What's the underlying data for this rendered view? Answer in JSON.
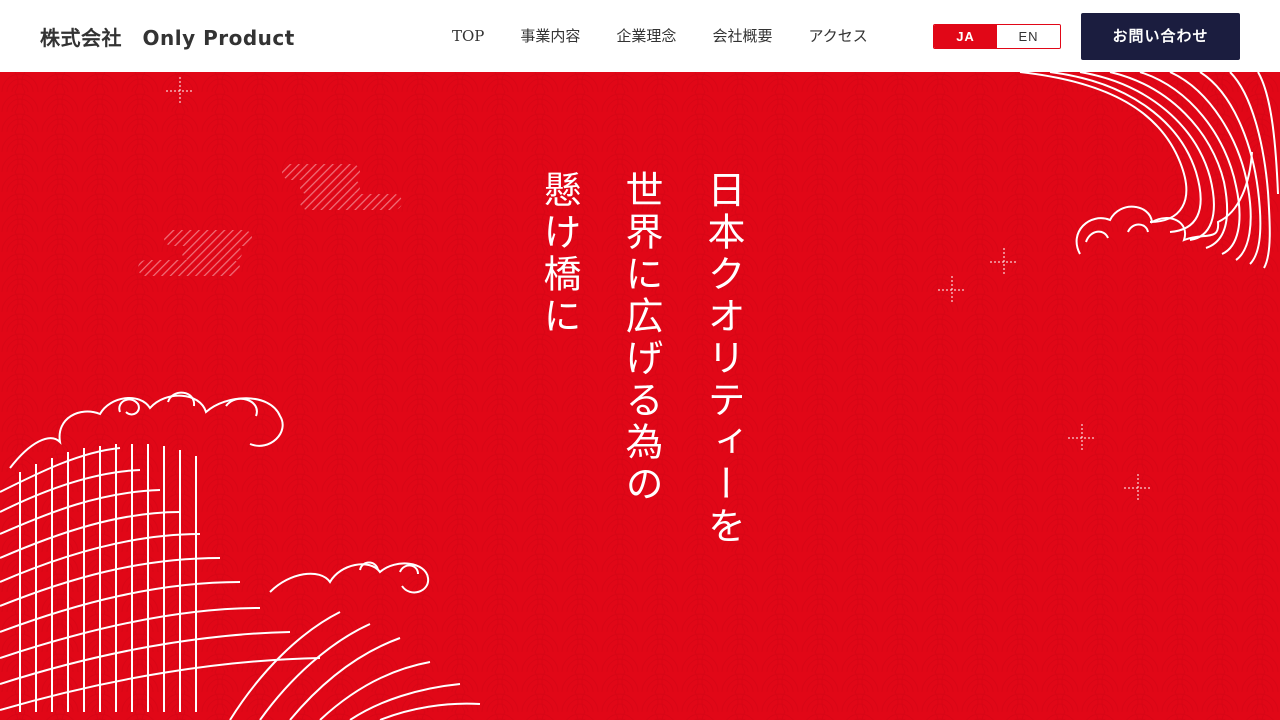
{
  "header": {
    "logo": "株式会社　Only Product",
    "nav": [
      "TOP",
      "事業内容",
      "企業理念",
      "会社概要",
      "アクセス"
    ],
    "lang": {
      "ja": "JA",
      "en": "EN",
      "active": "JA"
    },
    "contact_label": "お問い合わせ"
  },
  "hero": {
    "catch_lines": [
      "日本クオリティーを",
      "世界に広げる為の",
      "懸け橋に"
    ]
  },
  "colors": {
    "brand_red": "#e10717",
    "navy": "#1b1d3f",
    "text": "#333333"
  }
}
